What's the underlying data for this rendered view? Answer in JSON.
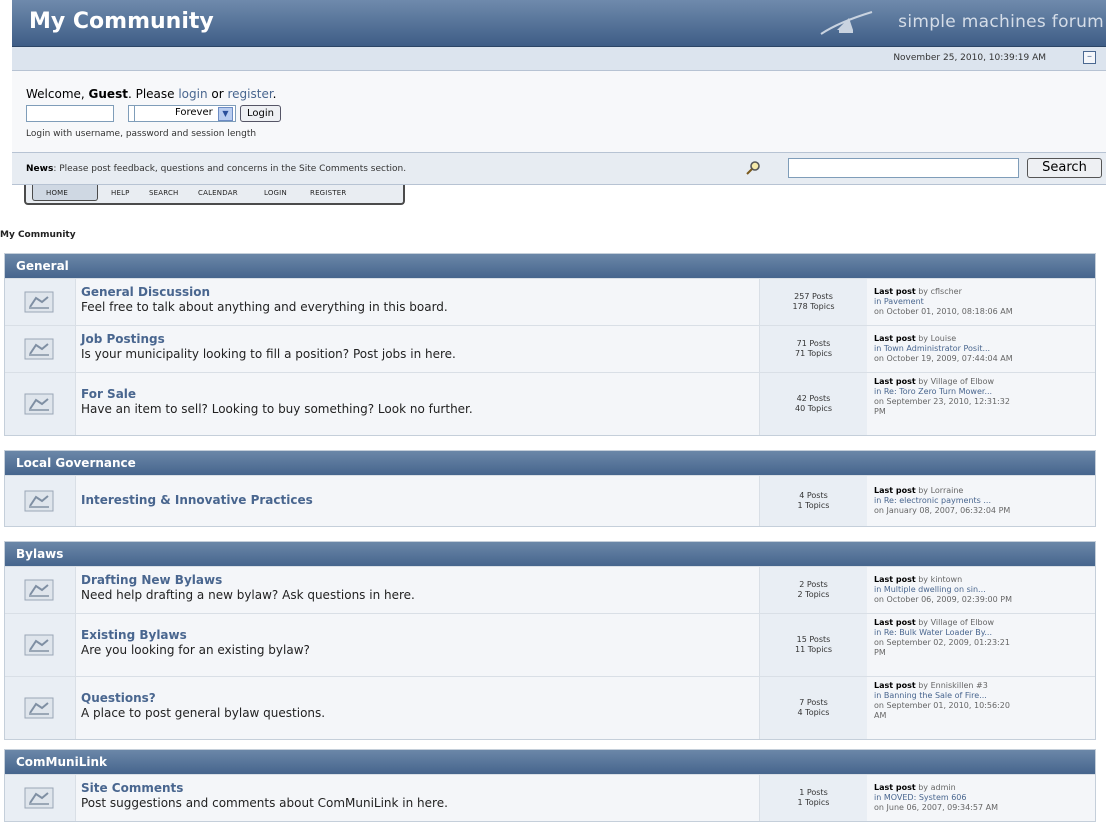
{
  "header": {
    "title": "My Community",
    "logo_text": "simple machines forum"
  },
  "datebar": {
    "date": "November 25, 2010, 10:39:19 AM"
  },
  "welcome": {
    "prefix": "Welcome, ",
    "guest": "Guest",
    "middle": ". Please ",
    "login": "login",
    "or": " or ",
    "register": "register",
    "suffix": ".",
    "session_select": "Forever",
    "login_button": "Login",
    "hint": "Login with username, password and session length"
  },
  "news": {
    "label": "News",
    "text": ": Please post feedback, questions and concerns in the Site Comments section.",
    "search_button": "Search"
  },
  "tabs": [
    "HOME",
    "HELP",
    "SEARCH",
    "CALENDAR",
    "LOGIN",
    "REGISTER"
  ],
  "breadcrumb": "My Community",
  "categories": [
    {
      "name": "General",
      "boards": [
        {
          "name": "General Discussion",
          "desc": "Feel free to talk about anything and everything in this board.",
          "posts": "257 Posts",
          "topics": "178 Topics",
          "last": [
            "Last post",
            " by cflscher",
            "in Pavement",
            "on October 01, 2010, 08:18:06 AM"
          ]
        },
        {
          "name": "Job Postings",
          "desc": "Is your municipality looking to fill a position? Post jobs in here.",
          "posts": "71 Posts",
          "topics": "71 Topics",
          "last": [
            "Last post",
            " by Louise",
            "in Town Administrator Posit...",
            "on October 19, 2009, 07:44:04 AM"
          ]
        },
        {
          "name": "For Sale",
          "desc": "Have an item to sell? Looking to buy something? Look no further.",
          "posts": "42 Posts",
          "topics": "40 Topics",
          "last": [
            "Last post",
            " by Village of Elbow",
            "in Re: Toro Zero Turn Mower...",
            "on September 23, 2010, 12:31:32",
            "PM"
          ]
        }
      ]
    },
    {
      "name": "Local Governance",
      "boards": [
        {
          "name": "Interesting & Innovative Practices",
          "desc": "",
          "posts": "4 Posts",
          "topics": "1 Topics",
          "last": [
            "Last post",
            " by Lorraine",
            "in Re: electronic payments ...",
            "on January 08, 2007, 06:32:04 PM"
          ]
        }
      ]
    },
    {
      "name": "Bylaws",
      "boards": [
        {
          "name": "Drafting New Bylaws",
          "desc": "Need help drafting a new bylaw? Ask questions in here.",
          "posts": "2 Posts",
          "topics": "2 Topics",
          "last": [
            "Last post",
            " by kintown",
            "in Multiple dwelling on sin...",
            "on October 06, 2009, 02:39:00 PM"
          ]
        },
        {
          "name": "Existing Bylaws",
          "desc": "Are you looking for an existing bylaw?",
          "posts": "15 Posts",
          "topics": "11 Topics",
          "last": [
            "Last post",
            " by Village of Elbow",
            "in Re: Bulk Water Loader By...",
            "on September 02, 2009, 01:23:21",
            "PM"
          ]
        },
        {
          "name": "Questions?",
          "desc": "A place to post general bylaw questions.",
          "posts": "7 Posts",
          "topics": "4 Topics",
          "last": [
            "Last post",
            " by Enniskillen #3",
            "in Banning the Sale of Fire...",
            "on September 01, 2010, 10:56:20",
            "AM"
          ]
        }
      ]
    },
    {
      "name": "ComMuniLink",
      "boards": [
        {
          "name": "Site Comments",
          "desc": "Post suggestions and comments about ComMuniLink in here.",
          "posts": "1 Posts",
          "topics": "1 Topics",
          "last": [
            "Last post",
            " by admin",
            "in MOVED: System 606",
            "on June 06, 2007, 09:34:57 AM"
          ]
        }
      ]
    }
  ]
}
